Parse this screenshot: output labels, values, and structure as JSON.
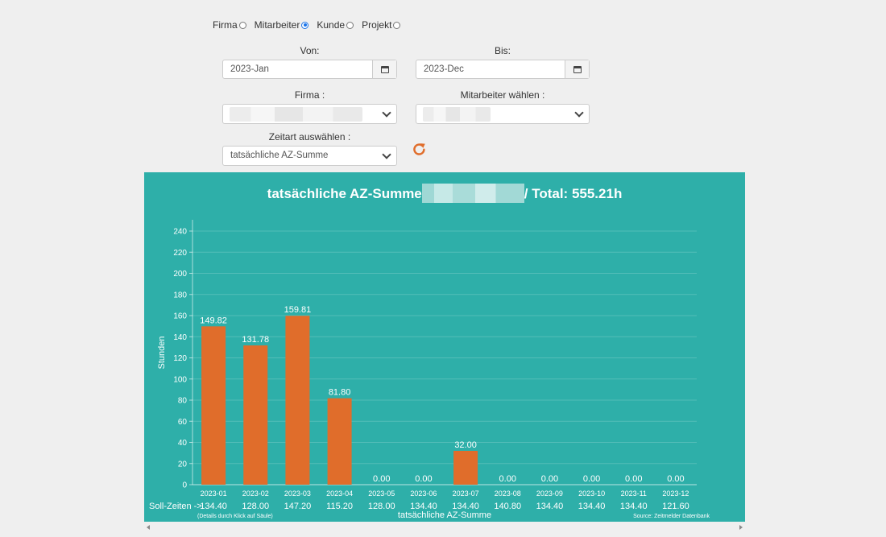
{
  "filters": {
    "radios": [
      {
        "label": "Firma",
        "checked": false
      },
      {
        "label": "Mitarbeiter",
        "checked": true
      },
      {
        "label": "Kunde",
        "checked": false
      },
      {
        "label": "Projekt",
        "checked": false
      }
    ],
    "von_label": "Von:",
    "von_value": "2023-Jan",
    "bis_label": "Bis:",
    "bis_value": "2023-Dec",
    "firma_label": "Firma :",
    "mitarbeiter_label": "Mitarbeiter wählen :",
    "zeitart_label": "Zeitart auswählen :",
    "zeitart_value": "tatsächliche AZ-Summe",
    "accent_color": "#e06d2b"
  },
  "chart_panel": {
    "title_prefix": "tatsächliche AZ-Summe",
    "title_suffix": "/ Total: 555.21h",
    "background": "#2eafa9",
    "soll_label": "Soll-Zeiten ->",
    "details_note": "(Details durch Klick auf Säule)",
    "source_note": "Source: Zeitmelder Datenbank"
  },
  "chart_data": {
    "type": "bar",
    "title": "tatsächliche AZ-Summe / Total: 555.21h",
    "xlabel": "tatsächliche AZ-Summe",
    "ylabel": "Stunden",
    "ylim": [
      0,
      240
    ],
    "yticks": [
      0,
      20,
      40,
      60,
      80,
      100,
      120,
      140,
      160,
      180,
      200,
      220,
      240
    ],
    "grid": true,
    "bar_color": "#e06d2b",
    "categories": [
      "2023-01",
      "2023-02",
      "2023-03",
      "2023-04",
      "2023-05",
      "2023-06",
      "2023-07",
      "2023-08",
      "2023-09",
      "2023-10",
      "2023-11",
      "2023-12"
    ],
    "values": [
      149.82,
      131.78,
      159.81,
      81.8,
      0.0,
      0.0,
      32.0,
      0.0,
      0.0,
      0.0,
      0.0,
      0.0
    ],
    "value_labels": [
      "149.82",
      "131.78",
      "159.81",
      "81.80",
      "0.00",
      "0.00",
      "32.00",
      "0.00",
      "0.00",
      "0.00",
      "0.00",
      "0.00"
    ],
    "soll_zeiten": [
      "134.40",
      "128.00",
      "147.20",
      "115.20",
      "128.00",
      "134.40",
      "134.40",
      "140.80",
      "134.40",
      "134.40",
      "134.40",
      "121.60"
    ]
  }
}
